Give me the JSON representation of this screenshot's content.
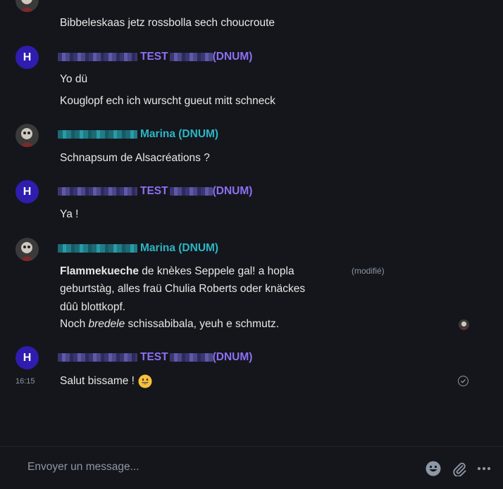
{
  "messages": {
    "m0": {
      "line1": "Bibbeleskaas jetz rossbolla sech choucroute"
    },
    "m1": {
      "sender_mid": "TEST",
      "sender_suffix": "(DNUM)",
      "avatar_letter": "H",
      "line1": "Yo dü",
      "line2": "Kouglopf ech ich wurscht gueut mitt schneck"
    },
    "m2": {
      "sender_name": "Marina (DNUM)",
      "line1": "Schnapsum de Alsacréations ?"
    },
    "m3": {
      "sender_mid": "TEST",
      "sender_suffix": "(DNUM)",
      "avatar_letter": "H",
      "line1": "Ya !"
    },
    "m4": {
      "sender_name": "Marina (DNUM)",
      "edited": "(modifié)",
      "bold": "Flammekueche",
      "line1_rest": " de knèkes Seppele gal! a hopla",
      "line2": "geburtstàg, alles fraü Chulia Roberts oder knäckes",
      "line3": "dûû blottkopf.",
      "line4_pre": "Noch ",
      "line4_italic": "bredele",
      "line4_post": " schissabibala, yeuh e schmutz."
    },
    "m5": {
      "sender_mid": "TEST",
      "sender_suffix": "(DNUM)",
      "avatar_letter": "H",
      "timestamp": "16:15",
      "text": "Salut bissame !"
    }
  },
  "composer": {
    "placeholder": "Envoyer un message...",
    "icons": [
      "emoji-icon",
      "attachment-icon",
      "more-options-icon"
    ]
  },
  "colors": {
    "background": "#15161b",
    "sender_purple": "#8e6ff7",
    "sender_teal": "#2bb6c7",
    "avatar_h": "#2f1db0",
    "muted": "#8d97a5"
  }
}
